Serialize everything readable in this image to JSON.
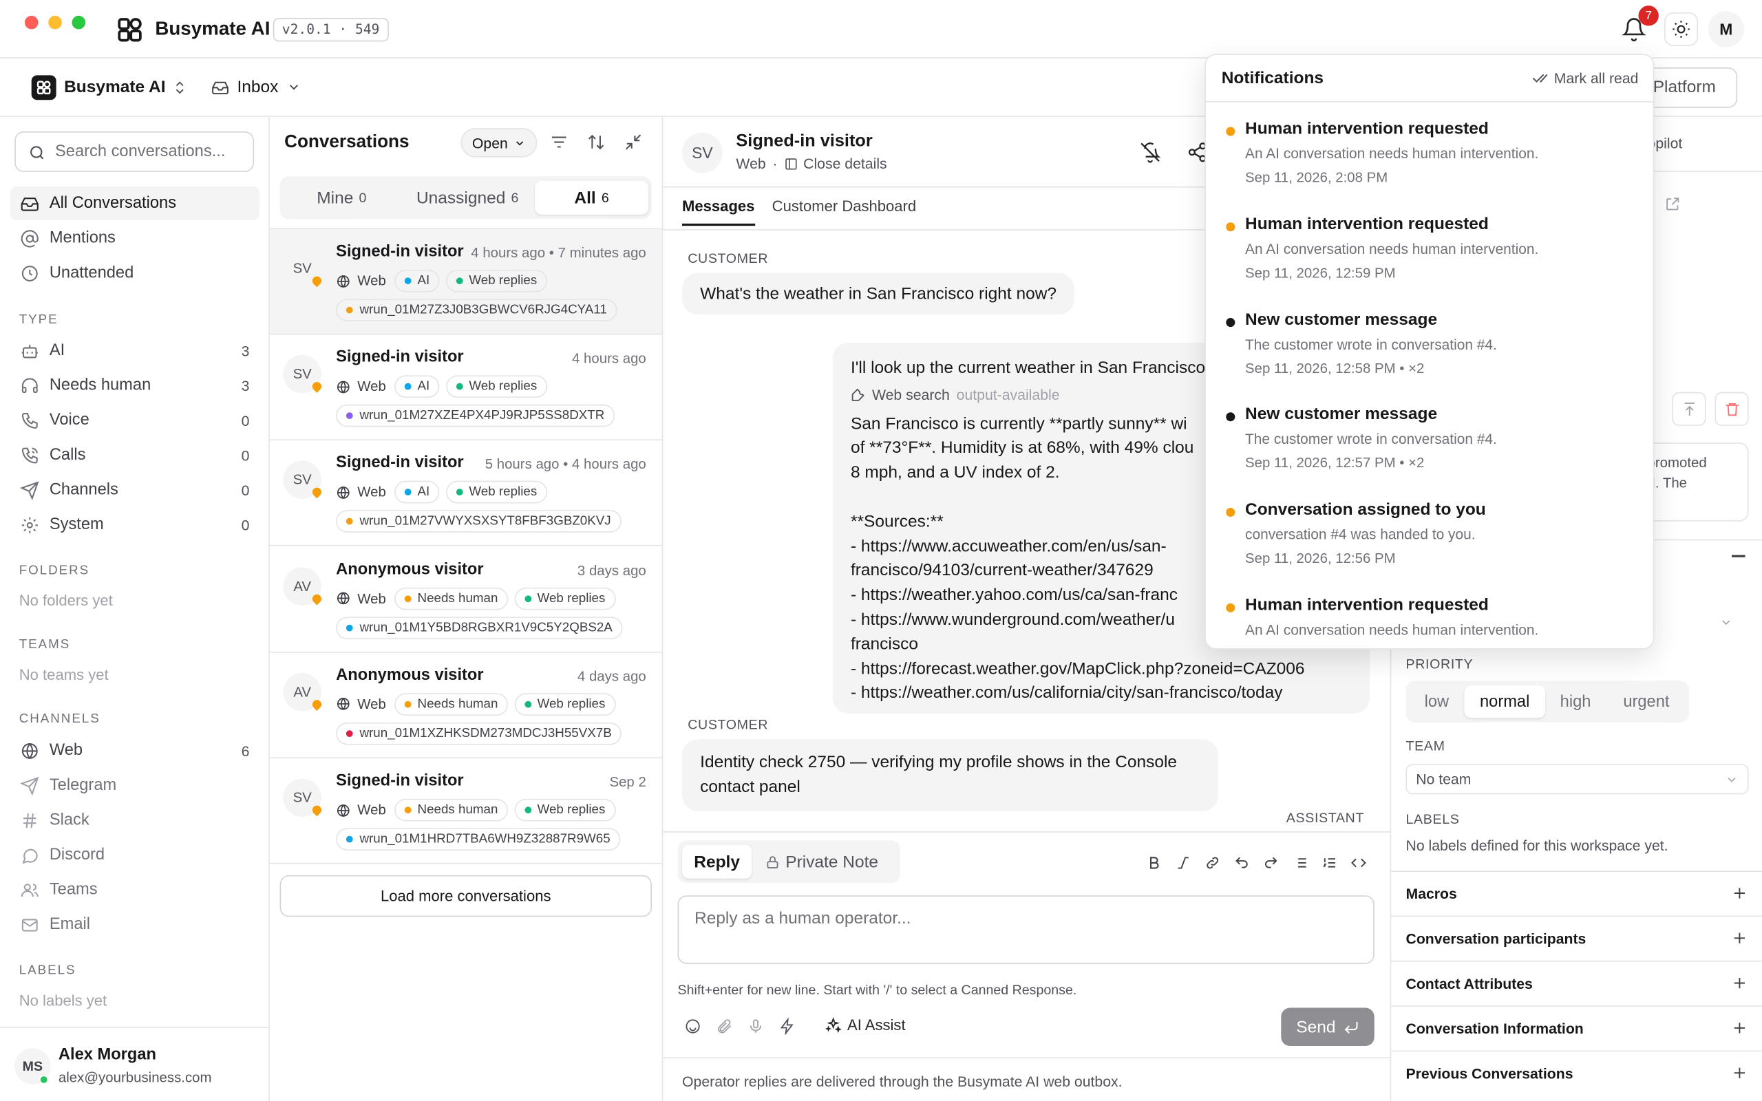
{
  "app": {
    "name": "Busymate AI",
    "version": "v2.0.1 · 549",
    "notification_count": "7",
    "user_initial": "M"
  },
  "topbar": {
    "workspace": "Busymate AI",
    "inbox": "Inbox",
    "platform_button": "Platform"
  },
  "sidebar": {
    "search_placeholder": "Search conversations...",
    "main_items": [
      {
        "label": "All Conversations",
        "icon": "inbox-icon"
      },
      {
        "label": "Mentions",
        "icon": "at-icon"
      },
      {
        "label": "Unattended",
        "icon": "clock-icon"
      }
    ],
    "type_heading": "TYPE",
    "type_items": [
      {
        "label": "AI",
        "count": "3",
        "icon": "bot-icon"
      },
      {
        "label": "Needs human",
        "count": "3",
        "icon": "headset-icon"
      },
      {
        "label": "Voice",
        "count": "0",
        "icon": "phone-icon"
      },
      {
        "label": "Calls",
        "count": "0",
        "icon": "phone-call-icon"
      },
      {
        "label": "Channels",
        "count": "0",
        "icon": "send-icon"
      },
      {
        "label": "System",
        "count": "0",
        "icon": "gear-icon"
      }
    ],
    "folders_heading": "FOLDERS",
    "folders_empty": "No folders yet",
    "teams_heading": "TEAMS",
    "teams_empty": "No teams yet",
    "channels_heading": "CHANNELS",
    "channel_items": [
      {
        "label": "Web",
        "count": "6",
        "icon": "globe-icon"
      },
      {
        "label": "Telegram",
        "count": "",
        "icon": "send-icon"
      },
      {
        "label": "Slack",
        "count": "",
        "icon": "hash-icon"
      },
      {
        "label": "Discord",
        "count": "",
        "icon": "chat-bubble-icon"
      },
      {
        "label": "Teams",
        "count": "",
        "icon": "users-icon"
      },
      {
        "label": "Email",
        "count": "",
        "icon": "mail-icon"
      }
    ],
    "labels_heading": "LABELS",
    "labels_empty": "No labels yet",
    "user": {
      "initials": "MS",
      "name": "Alex Morgan",
      "email": "alex@yourbusiness.com"
    }
  },
  "conversations": {
    "title": "Conversations",
    "status_filter": "Open",
    "tabs": [
      {
        "label": "Mine",
        "count": "0"
      },
      {
        "label": "Unassigned",
        "count": "6"
      },
      {
        "label": "All",
        "count": "6"
      }
    ],
    "items": [
      {
        "initials": "SV",
        "name": "Signed-in visitor",
        "time": "4 hours ago • 7 minutes ago",
        "channel": "Web",
        "tag": "AI",
        "tag_color": "#0ea5e9",
        "reply": "Web replies",
        "run": "wrun_01M27Z3J0B3GBWCV6RJG4CYA11",
        "run_color": "#f59e0b"
      },
      {
        "initials": "SV",
        "name": "Signed-in visitor",
        "time": "4 hours ago",
        "channel": "Web",
        "tag": "AI",
        "tag_color": "#0ea5e9",
        "reply": "Web replies",
        "run": "wrun_01M27XZE4PX4PJ9RJP5SS8DXTR",
        "run_color": "#8b5cf6"
      },
      {
        "initials": "SV",
        "name": "Signed-in visitor",
        "time": "5 hours ago • 4 hours ago",
        "channel": "Web",
        "tag": "AI",
        "tag_color": "#0ea5e9",
        "reply": "Web replies",
        "run": "wrun_01M27VWYXSXSYT8FBF3GBZ0KVJ",
        "run_color": "#f59e0b"
      },
      {
        "initials": "AV",
        "name": "Anonymous visitor",
        "time": "3 days ago",
        "channel": "Web",
        "tag": "Needs human",
        "tag_color": "#f59e0b",
        "reply": "Web replies",
        "run": "wrun_01M1Y5BD8RGBXR1V9C5Y2QBS2A",
        "run_color": "#0ea5e9"
      },
      {
        "initials": "AV",
        "name": "Anonymous visitor",
        "time": "4 days ago",
        "channel": "Web",
        "tag": "Needs human",
        "tag_color": "#f59e0b",
        "reply": "Web replies",
        "run": "wrun_01M1XZHKSDM273MDCJ3H55VX7B",
        "run_color": "#e11d48"
      },
      {
        "initials": "SV",
        "name": "Signed-in visitor",
        "time": "Sep 2",
        "channel": "Web",
        "tag": "Needs human",
        "tag_color": "#f59e0b",
        "reply": "Web replies",
        "run": "wrun_01M1HRD7TBA6WH9Z32887R9W65",
        "run_color": "#0ea5e9"
      }
    ],
    "load_more": "Load more conversations"
  },
  "chat": {
    "initials": "SV",
    "name": "Signed-in visitor",
    "channel": "Web",
    "close_details": "Close details",
    "tabs": [
      "Messages",
      "Customer Dashboard"
    ],
    "customer_label": "CUSTOMER",
    "assistant_label": "ASSISTANT",
    "msg1": "What's the weather in San Francisco right now?",
    "reply_intro": "I'll look up the current weather in San Francisco",
    "tool_name": "Web search",
    "tool_status": "output-available",
    "reply_lines": [
      "San Francisco is currently **partly sunny** wi",
      "of **73°F**. Humidity is at 68%, with 49% clou",
      "8 mph, and a UV index of 2.",
      "",
      "**Sources:**",
      "- https://www.accuweather.com/en/us/san-",
      "francisco/94103/current-weather/347629",
      "- https://weather.yahoo.com/us/ca/san-franc",
      "- https://www.wunderground.com/weather/u",
      "francisco",
      "- https://forecast.weather.gov/MapClick.php?zoneid=CAZ006",
      "- https://weather.com/us/california/city/san-francisco/today"
    ],
    "msg2_line1": "Identity check 2750 — verifying my profile shows in the Console",
    "msg2_line2": "contact panel",
    "composer": {
      "reply_tab": "Reply",
      "note_tab": "Private Note",
      "placeholder": "Reply as a human operator...",
      "hint": "Shift+enter for new line. Start with '/' to select a Canned Response.",
      "ai_assist": "AI Assist",
      "send": "Send"
    },
    "footer": "Operator replies are delivered through the Busymate AI web outbox."
  },
  "right_panel": {
    "copilot": "opilot",
    "snippet1": "promoted",
    "snippet2": "d. The",
    "priority_label": "PRIORITY",
    "priorities": [
      "low",
      "normal",
      "high",
      "urgent"
    ],
    "team_label": "TEAM",
    "team_value": "No team",
    "labels_label": "LABELS",
    "labels_empty": "No labels defined for this workspace yet.",
    "sections": [
      "Macros",
      "Conversation participants",
      "Contact Attributes",
      "Conversation Information",
      "Previous Conversations"
    ]
  },
  "notifications": {
    "title": "Notifications",
    "mark_all": "Mark all read",
    "items": [
      {
        "title": "Human intervention requested",
        "body": "An AI conversation needs human intervention.",
        "stamp": "Sep 11, 2026, 2:08 PM",
        "color": "#f59e0b"
      },
      {
        "title": "Human intervention requested",
        "body": "An AI conversation needs human intervention.",
        "stamp": "Sep 11, 2026, 12:59 PM",
        "color": "#f59e0b"
      },
      {
        "title": "New customer message",
        "body": "The customer wrote in conversation #4.",
        "stamp": "Sep 11, 2026, 12:58 PM • ×2",
        "color": "#18181b"
      },
      {
        "title": "New customer message",
        "body": "The customer wrote in conversation #4.",
        "stamp": "Sep 11, 2026, 12:57 PM • ×2",
        "color": "#18181b"
      },
      {
        "title": "Conversation assigned to you",
        "body": "conversation #4 was handed to you.",
        "stamp": "Sep 11, 2026, 12:56 PM",
        "color": "#f59e0b"
      },
      {
        "title": "Human intervention requested",
        "body": "An AI conversation needs human intervention.",
        "stamp": "",
        "color": "#f59e0b"
      }
    ]
  }
}
